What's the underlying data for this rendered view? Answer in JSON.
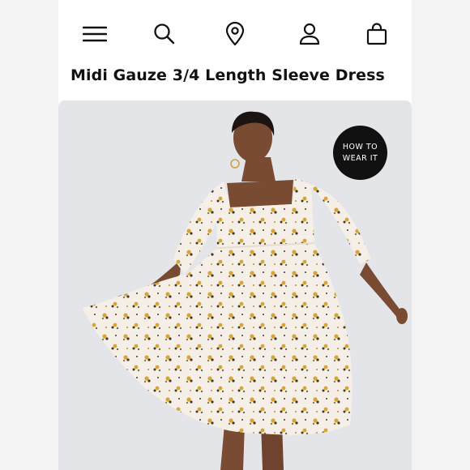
{
  "header": {
    "icons": [
      "menu-icon",
      "search-icon",
      "location-pin-icon",
      "account-icon",
      "shopping-bag-icon"
    ]
  },
  "product": {
    "title": "Midi Gauze 3/4 Length Sleeve Dress",
    "how_to_wear_label": "HOW TO WEAR IT"
  },
  "colors": {
    "background": "#f3f3f3",
    "page": "#ffffff",
    "hero_background": "#e4e5e9",
    "dress": "#f6efe7",
    "print_yellow": "#d9a532",
    "print_dark": "#3c3a2e",
    "badge": "#111111"
  }
}
